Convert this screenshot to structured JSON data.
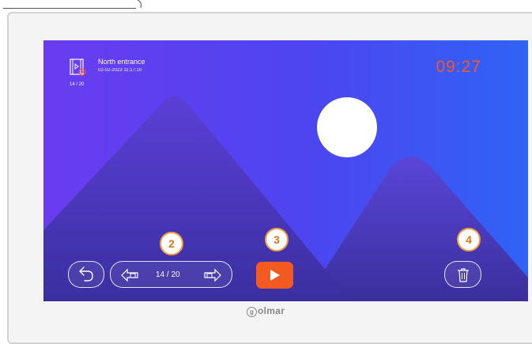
{
  "record": {
    "location": "North entrance",
    "datetime": "02-02-2023   11:17:10",
    "counter": "14 / 20"
  },
  "clock": "09:27",
  "navigation": {
    "page": "14 / 20"
  },
  "callouts": [
    "2",
    "3",
    "4"
  ],
  "brand": {
    "logo_text": "olmar",
    "logo_initial": "g"
  },
  "colors": {
    "accent": "#f25a22",
    "clock": "#f05a28",
    "badge_border": "#f59a3c"
  },
  "icons": {
    "record": "video-file-icon",
    "back": "back-arrow-icon",
    "prev": "previous-record-icon",
    "next": "next-record-icon",
    "play": "play-icon",
    "delete": "trash-icon"
  }
}
